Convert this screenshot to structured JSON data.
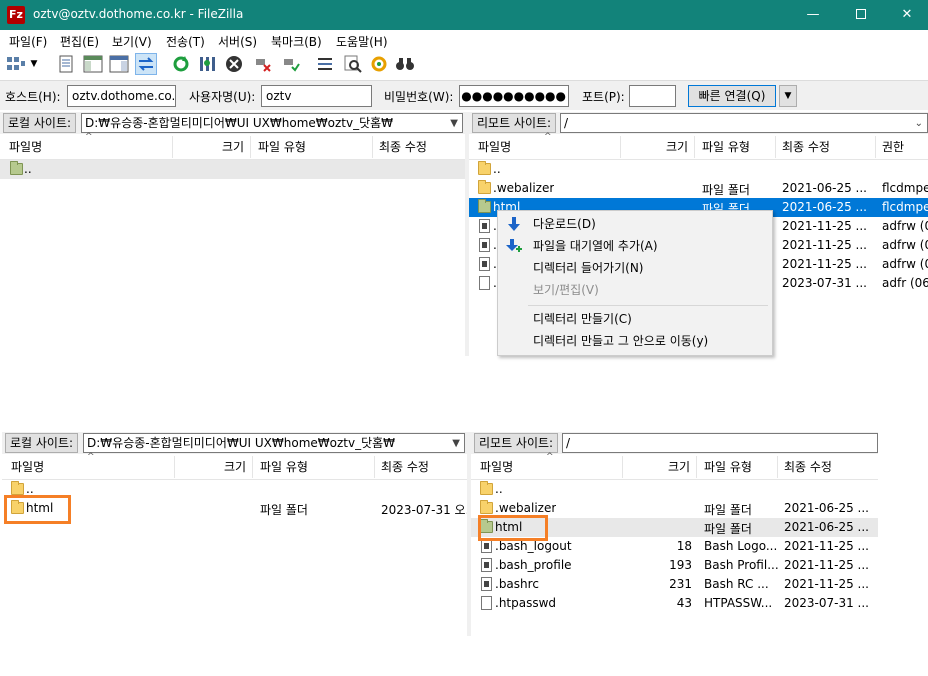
{
  "window": {
    "app_icon": "Fz",
    "title": "oztv@oztv.dothome.co.kr - FileZilla",
    "minimize": "—",
    "close": "✕"
  },
  "menu": [
    "파일(F)",
    "편집(E)",
    "보기(V)",
    "전송(T)",
    "서버(S)",
    "북마크(B)",
    "도움말(H)"
  ],
  "toolbar_icons": [
    "site-manager-icon",
    "dropdown-arrow-icon",
    "message-log-icon",
    "local-tree-icon",
    "remote-tree-icon",
    "transfer-queue-icon",
    "refresh-icon",
    "filter-icon",
    "cancel-icon",
    "disconnect-icon",
    "reconnect-icon",
    "compare-icon",
    "search-remote-icon",
    "sync-browse-icon",
    "binoculars-icon"
  ],
  "quickconnect": {
    "host_label": "호스트(H):",
    "host_value": "oztv.dothome.co.kr",
    "user_label": "사용자명(U):",
    "user_value": "oztv",
    "pass_label": "비밀번호(W):",
    "pass_value": "●●●●●●●●●●",
    "port_label": "포트(P):",
    "port_value": "",
    "connect_button": "빠른 연결(Q)",
    "dropdown": "▼"
  },
  "top": {
    "local": {
      "site_label": "로컬 사이트:",
      "path": "D:₩유승종-혼합멀티미디어₩UI UX₩home₩oztv_닷홈₩",
      "columns": [
        "파일명",
        "크기",
        "파일 유형",
        "최종 수정"
      ],
      "rows": [
        {
          "name": "..",
          "size": "",
          "type": "",
          "modified": ""
        }
      ]
    },
    "remote": {
      "site_label": "리모트 사이트:",
      "path": "/",
      "columns": [
        "파일명",
        "크기",
        "파일 유형",
        "최종 수정",
        "권한"
      ],
      "rows": [
        {
          "name": "..",
          "size": "",
          "type": "",
          "modified": "",
          "perm": ""
        },
        {
          "name": ".webalizer",
          "size": "",
          "type": "파일 폴더",
          "modified": "2021-06-25 ...",
          "perm": "flcdmpe"
        },
        {
          "name": "html",
          "size": "",
          "type": "파일 폴더",
          "modified": "2021-06-25 ...",
          "perm": "flcdmpe"
        },
        {
          "name": ".",
          "size": "",
          "type": "",
          "modified": "2021-11-25 ...",
          "perm": "adfrw (0"
        },
        {
          "name": ".",
          "size": "",
          "type": "",
          "modified": "2021-11-25 ...",
          "perm": "adfrw (0"
        },
        {
          "name": ".",
          "size": "",
          "type": "",
          "modified": "2021-11-25 ...",
          "perm": "adfrw (0"
        },
        {
          "name": ".",
          "size": "",
          "type": "",
          "modified": "2023-07-31 ...",
          "perm": "adfr (06"
        }
      ]
    },
    "context_menu": [
      {
        "label": "다운로드(D)",
        "icon": "download-arrow-icon",
        "enabled": true
      },
      {
        "label": "파일을 대기열에 추가(A)",
        "icon": "add-to-queue-icon",
        "enabled": true
      },
      {
        "label": "디렉터리 들어가기(N)",
        "icon": "",
        "enabled": true
      },
      {
        "label": "보기/편집(V)",
        "icon": "",
        "enabled": false
      },
      {
        "label": "디렉터리 만들기(C)",
        "icon": "",
        "enabled": true
      },
      {
        "label": "디렉터리 만들고 그 안으로 이동(y)",
        "icon": "",
        "enabled": true
      }
    ]
  },
  "bottom": {
    "local": {
      "site_label": "로컬 사이트:",
      "path": "D:₩유승종-혼합멀티미디어₩UI UX₩home₩oztv_닷홈₩",
      "columns": [
        "파일명",
        "크기",
        "파일 유형",
        "최종 수정"
      ],
      "rows": [
        {
          "name": "..",
          "size": "",
          "type": "",
          "modified": ""
        },
        {
          "name": "html",
          "size": "",
          "type": "파일 폴더",
          "modified": "2023-07-31 오..."
        }
      ]
    },
    "remote": {
      "site_label": "리모트 사이트:",
      "path": "/",
      "columns": [
        "파일명",
        "크기",
        "파일 유형",
        "최종 수정"
      ],
      "rows": [
        {
          "name": "..",
          "size": "",
          "type": "",
          "modified": ""
        },
        {
          "name": ".webalizer",
          "size": "",
          "type": "파일 폴더",
          "modified": "2021-06-25 ..."
        },
        {
          "name": "html",
          "size": "",
          "type": "파일 폴더",
          "modified": "2021-06-25 ..."
        },
        {
          "name": ".bash_logout",
          "size": "18",
          "type": "Bash Logo...",
          "modified": "2021-11-25 ..."
        },
        {
          "name": ".bash_profile",
          "size": "193",
          "type": "Bash Profil...",
          "modified": "2021-11-25 ..."
        },
        {
          "name": ".bashrc",
          "size": "231",
          "type": "Bash RC ...",
          "modified": "2021-11-25 ..."
        },
        {
          "name": ".htpasswd",
          "size": "43",
          "type": "HTPASSW...",
          "modified": "2023-07-31 ..."
        }
      ]
    }
  },
  "colors": {
    "titlebar": "#12837a",
    "selection": "#0078d7",
    "highlight": "#f57f26"
  }
}
